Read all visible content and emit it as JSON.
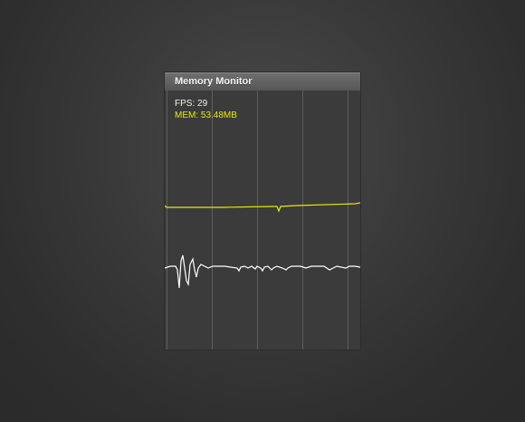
{
  "window": {
    "title": "Memory Monitor"
  },
  "stats": {
    "fps_label": "FPS: 29",
    "mem_label": "MEM: 53.48MB"
  },
  "colors": {
    "mem_line": "#e8e800",
    "fps_line": "#ffffff",
    "panel_bg": "#3b3b3b",
    "grid": "#5e5e5e"
  },
  "graphs": {
    "mem_trace": [
      148,
      149,
      149,
      149,
      149,
      149,
      149,
      149,
      149,
      149,
      149,
      149,
      149,
      149,
      149,
      149,
      149,
      149,
      149,
      149,
      149,
      148,
      148,
      148,
      148,
      148,
      148,
      148,
      148,
      148,
      148,
      148,
      148,
      148,
      148,
      148,
      148,
      148,
      148,
      148,
      148,
      148,
      148,
      148,
      148,
      148,
      148,
      148,
      148,
      148,
      148,
      148,
      148,
      148,
      148,
      148,
      148,
      148,
      148,
      148,
      148,
      148,
      148,
      148,
      148,
      148,
      148,
      148,
      148,
      148,
      148,
      148,
      148,
      148,
      148,
      148,
      148,
      148,
      148,
      148,
      148,
      148,
      148,
      148,
      148,
      148,
      148,
      148,
      148,
      148,
      148,
      148,
      148,
      148,
      148,
      148,
      148,
      148,
      148,
      148,
      148,
      148,
      148,
      148,
      148,
      148,
      148,
      148,
      148,
      148,
      148,
      148,
      148,
      148,
      148,
      148,
      148,
      148,
      148,
      148,
      148,
      148,
      148,
      148,
      148,
      148,
      148,
      148,
      148,
      148,
      147,
      147,
      147,
      147,
      147,
      147,
      147,
      147,
      147,
      147,
      147,
      147,
      147,
      147,
      147,
      147,
      147,
      147,
      147,
      147,
      147,
      147,
      147,
      147,
      147,
      147,
      147,
      147,
      147,
      147,
      147,
      147,
      147,
      147,
      147,
      147,
      147,
      147,
      147,
      147,
      147,
      147,
      147,
      147,
      147,
      147,
      147,
      147,
      147,
      147,
      147,
      147,
      147,
      147,
      147,
      147,
      147,
      147,
      147,
      147,
      147,
      147,
      147,
      147,
      147,
      147,
      147,
      147,
      147,
      146,
      146,
      146,
      146,
      146,
      146,
      146,
      146,
      146,
      146,
      146,
      146,
      146,
      146,
      146,
      146,
      146,
      146,
      146,
      146,
      146
    ],
    "fps_trace": [
      214,
      214,
      212,
      214,
      214,
      214,
      214,
      214,
      214,
      214,
      214,
      214,
      214,
      214,
      214,
      216,
      236,
      210,
      204,
      222,
      238,
      214,
      208,
      206,
      214,
      218,
      214,
      214,
      214,
      214,
      214,
      214,
      214,
      214,
      214,
      214,
      214,
      214,
      214,
      214,
      214,
      214,
      214,
      214,
      214,
      214,
      214,
      214,
      214,
      214,
      214,
      214,
      214,
      214,
      214,
      214,
      214,
      214,
      214,
      214,
      214,
      214,
      214,
      214,
      214,
      214,
      214,
      214,
      214,
      214,
      214,
      214,
      214,
      214,
      214,
      214,
      214,
      214,
      214,
      214,
      214,
      214,
      214,
      214,
      214,
      214,
      214,
      214,
      214,
      214,
      214,
      214,
      214,
      214,
      214,
      214,
      214,
      214,
      214,
      214,
      214,
      214,
      214,
      214,
      214,
      214,
      214,
      214,
      214,
      214,
      214,
      214,
      214,
      214,
      214,
      214,
      214,
      214,
      214,
      214,
      214,
      214,
      214,
      214,
      214,
      214,
      214,
      214,
      214,
      214,
      214,
      214,
      214,
      214,
      214,
      214,
      214,
      214,
      214,
      214,
      214,
      214,
      214,
      214,
      214,
      214,
      214,
      214,
      214,
      214,
      214,
      214,
      214,
      214,
      214,
      214,
      214,
      214,
      214,
      214,
      214,
      214,
      214,
      214,
      214,
      214,
      214,
      214,
      214,
      214,
      214,
      214,
      214,
      214,
      214,
      214,
      214,
      214,
      214,
      214,
      214,
      214,
      214,
      214,
      214,
      214,
      214,
      214,
      214,
      214,
      214,
      214,
      214,
      214,
      214,
      214,
      214,
      214,
      214,
      214,
      214,
      214,
      214,
      214,
      214,
      214,
      214,
      214,
      214,
      214,
      214,
      214,
      214,
      214,
      214
    ]
  }
}
